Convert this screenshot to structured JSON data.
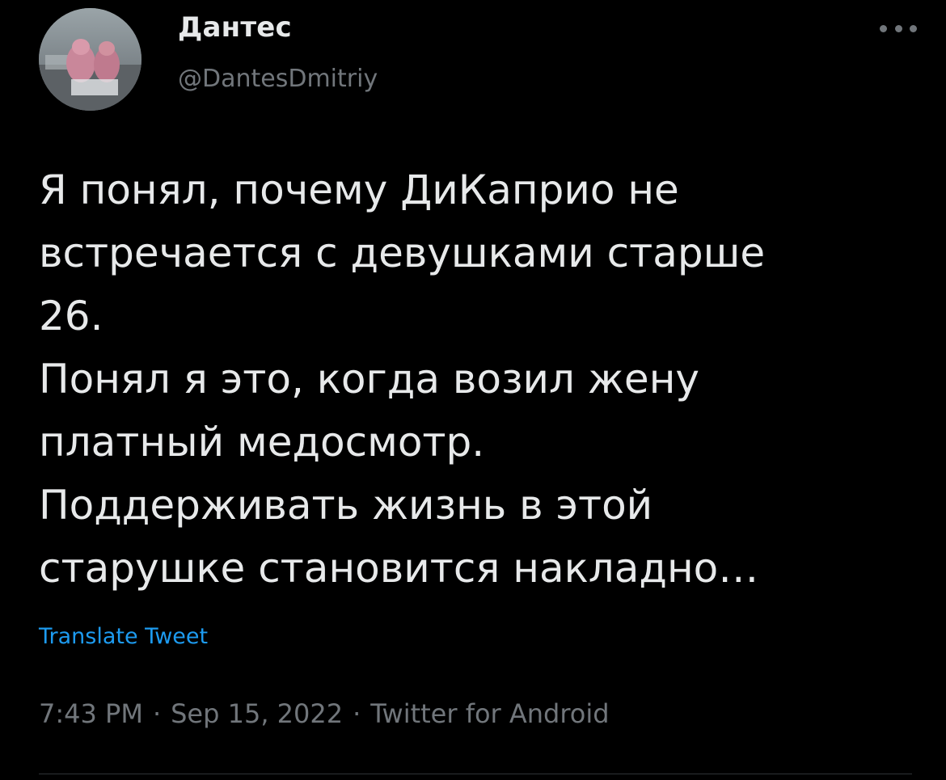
{
  "author": {
    "display_name": "Дантес",
    "handle": "@DantesDmitriy"
  },
  "tweet": {
    "text": "Я понял, почему ДиКаприо не\nвстречается с девушками старше\n26.\nПонял я это, когда возил жену\nплатный медосмотр.\nПоддерживать жизнь в этой\nстарушке становится накладно…",
    "translate_label": "Translate Tweet"
  },
  "meta": {
    "time": "7:43 PM",
    "date": "Sep 15, 2022",
    "source": "Twitter for Android",
    "separator": "·"
  },
  "icons": {
    "more": "more-options-icon",
    "avatar": "profile-avatar"
  },
  "colors": {
    "background": "#000000",
    "text": "#e7e9ea",
    "secondary": "#71767b",
    "link": "#1d9bf0"
  }
}
